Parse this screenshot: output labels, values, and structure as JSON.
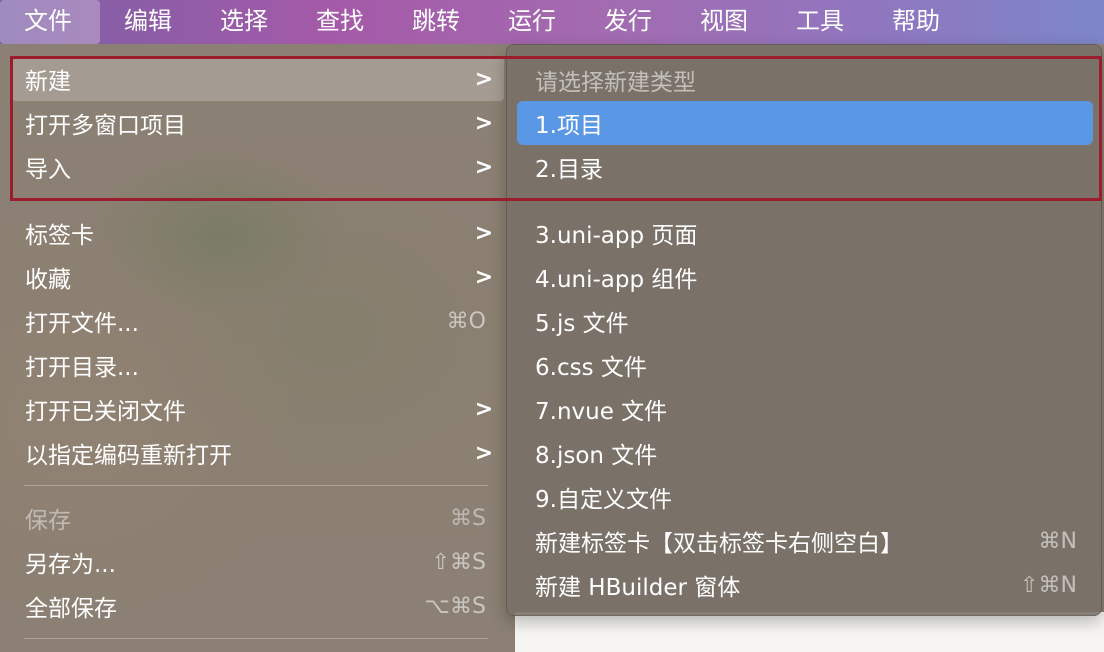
{
  "menubar": {
    "items": [
      {
        "label": "文件",
        "active": true
      },
      {
        "label": "编辑"
      },
      {
        "label": "选择"
      },
      {
        "label": "查找"
      },
      {
        "label": "跳转"
      },
      {
        "label": "运行"
      },
      {
        "label": "发行"
      },
      {
        "label": "视图"
      },
      {
        "label": "工具"
      },
      {
        "label": "帮助"
      }
    ]
  },
  "file_menu": {
    "arrow_glyph": ">",
    "items": [
      {
        "label": "新建",
        "submenu": true,
        "hover": true
      },
      {
        "label": "打开多窗口项目",
        "submenu": true
      },
      {
        "label": "导入",
        "submenu": true
      },
      {
        "label": "标签卡",
        "submenu": true
      },
      {
        "label": "收藏",
        "submenu": true
      },
      {
        "label": "打开文件...",
        "shortcut": "⌘O"
      },
      {
        "label": "打开目录..."
      },
      {
        "label": "打开已关闭文件",
        "submenu": true
      },
      {
        "label": "以指定编码重新打开",
        "submenu": true
      },
      {
        "label": "保存",
        "shortcut": "⌘S",
        "disabled": true
      },
      {
        "label": "另存为...",
        "shortcut": "⇧⌘S"
      },
      {
        "label": "全部保存",
        "shortcut": "⌥⌘S"
      }
    ]
  },
  "new_submenu": {
    "header": "请选择新建类型",
    "items": [
      {
        "label": "1.项目",
        "selected": true
      },
      {
        "label": "2.目录"
      },
      {
        "label": "3.uni-app 页面"
      },
      {
        "label": "4.uni-app 组件"
      },
      {
        "label": "5.js 文件"
      },
      {
        "label": "6.css 文件"
      },
      {
        "label": "7.nvue 文件"
      },
      {
        "label": "8.json 文件"
      },
      {
        "label": "9.自定义文件"
      },
      {
        "label": "新建标签卡【双击标签卡右侧空白】",
        "shortcut": "⌘N"
      },
      {
        "label": "新建 HBuilder 窗体",
        "shortcut": "⇧⌘N"
      }
    ]
  },
  "colors": {
    "selection": "#5a97e4",
    "annotation_box": "#9b1c2c"
  }
}
